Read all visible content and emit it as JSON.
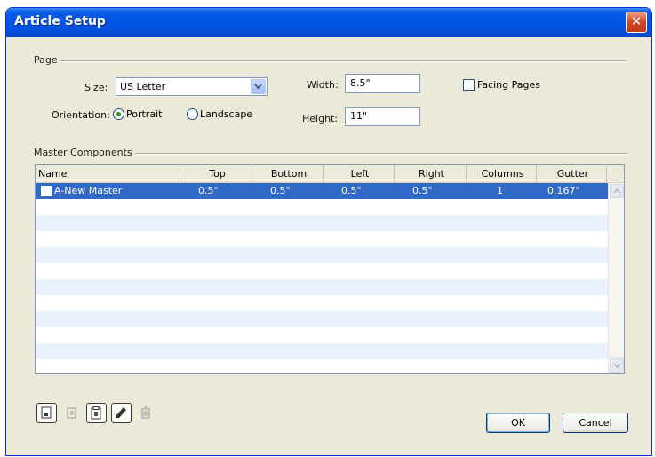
{
  "window": {
    "title": "Article Setup"
  },
  "page": {
    "group_label": "Page",
    "size_label": "Size:",
    "size_value": "US Letter",
    "orientation_label": "Orientation:",
    "portrait_label": "Portrait",
    "landscape_label": "Landscape",
    "orientation_selected": "Portrait",
    "width_label": "Width:",
    "width_value": "8.5\"",
    "height_label": "Height:",
    "height_value": "11\"",
    "facing_pages_label": "Facing Pages",
    "facing_pages_checked": false
  },
  "master": {
    "group_label": "Master Components",
    "columns": [
      "Name",
      "Top",
      "Bottom",
      "Left",
      "Right",
      "Columns",
      "Gutter"
    ],
    "rows": [
      {
        "name": "A-New Master",
        "top": "0.5\"",
        "bottom": "0.5\"",
        "left": "0.5\"",
        "right": "0.5\"",
        "columns": "1",
        "gutter": "0.167\""
      }
    ],
    "selected_row": 0
  },
  "toolbar": {
    "icons": [
      "new-master-icon",
      "duplicate-master-icon",
      "paste-master-icon",
      "edit-master-icon",
      "delete-master-icon"
    ]
  },
  "buttons": {
    "ok": "OK",
    "cancel": "Cancel"
  },
  "colors": {
    "titlebar": "#0054e3",
    "selection": "#3169c6",
    "dialog_bg": "#ece9d8",
    "row_alt": "#e9f1fb"
  }
}
